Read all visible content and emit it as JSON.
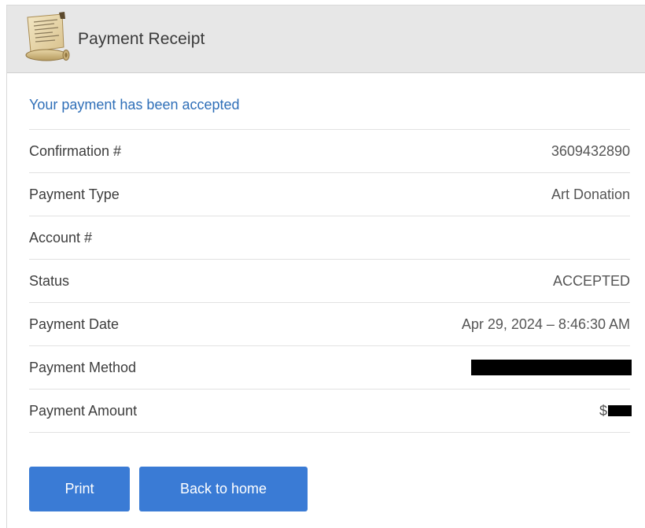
{
  "header": {
    "title": "Payment Receipt",
    "icon": "scroll-icon"
  },
  "message": "Your payment has been accepted",
  "details": [
    {
      "label": "Confirmation #",
      "value": "3609432890"
    },
    {
      "label": "Payment Type",
      "value": "Art Donation"
    },
    {
      "label": "Account #",
      "value": ""
    },
    {
      "label": "Status",
      "value": "ACCEPTED"
    },
    {
      "label": "Payment Date",
      "value": "Apr 29, 2024 – 8:46:30 AM"
    },
    {
      "label": "Payment Method",
      "value": ""
    },
    {
      "label": "Payment Amount",
      "value": "$"
    }
  ],
  "buttons": {
    "print": "Print",
    "home": "Back to home"
  },
  "colors": {
    "accent": "#3a7bd5",
    "message": "#2f6fb8",
    "header_bg": "#e7e7e7"
  }
}
